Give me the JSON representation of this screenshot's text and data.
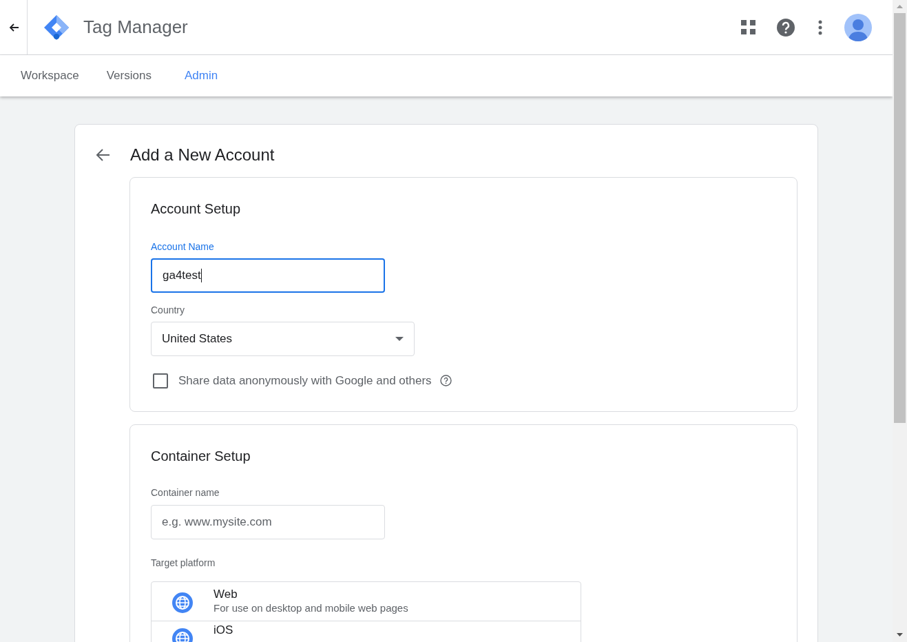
{
  "app_bar": {
    "title": "Tag Manager"
  },
  "tabs": [
    {
      "label": "Workspace",
      "selected": false
    },
    {
      "label": "Versions",
      "selected": false
    },
    {
      "label": "Admin",
      "selected": true
    }
  ],
  "page": {
    "title": "Add a New Account"
  },
  "account_setup": {
    "heading": "Account Setup",
    "account_name": {
      "label": "Account Name",
      "value": "ga4test",
      "focused": true
    },
    "country": {
      "label": "Country",
      "value": "United States"
    },
    "share_data": {
      "label": "Share data anonymously with Google and others",
      "checked": false
    }
  },
  "container_setup": {
    "heading": "Container Setup",
    "container_name": {
      "label": "Container name",
      "placeholder": "e.g. www.mysite.com"
    },
    "target_platform": {
      "label": "Target platform",
      "options": [
        {
          "title": "Web",
          "description": "For use on desktop and mobile web pages"
        },
        {
          "title": "iOS"
        }
      ]
    }
  }
}
